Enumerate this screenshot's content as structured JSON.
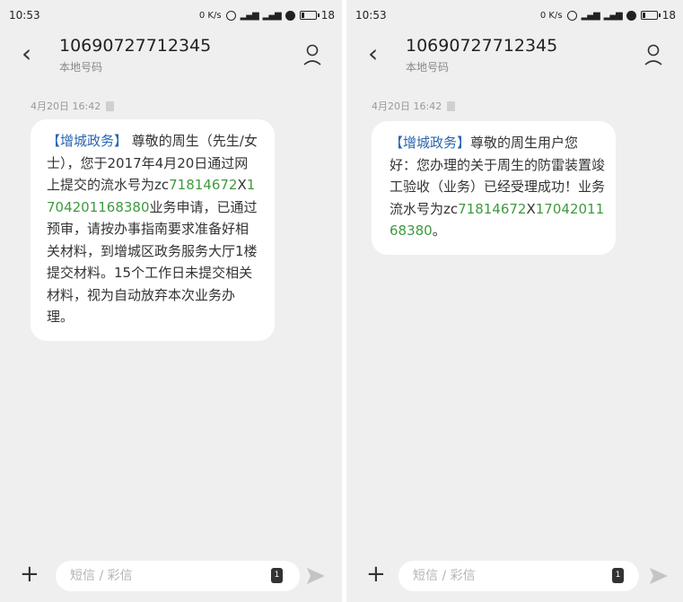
{
  "status": {
    "time": "10:53",
    "speed": "0 K/s",
    "network": "4G",
    "battery": "18"
  },
  "conversation": {
    "phone_number": "10690727712345",
    "number_type": "本地号码",
    "timestamp": "4月20日 16:42"
  },
  "messages": [
    {
      "brand": "【增城政务】",
      "text_before": " 尊敬的周生（先生/女士），您于2017年4月20日通过网上提交的流水号为zc",
      "num1": "71814672",
      "sep": "X",
      "num2": "1704201168380",
      "text_after": "业务申请，已通过预审，请按办事指南要求准备好相关材料，到增城区政务服务大厅1楼提交材料。15个工作日未提交相关材料，视为自动放弃本次业务办理。"
    },
    {
      "brand": "【增城政务】",
      "text_before": "尊敬的周生用户您好：您办理的关于周生的防雷装置竣工验收（业务）已经受理成功！业务流水号为zc",
      "num1": "71814672",
      "sep": "X",
      "num2": "1704201168380",
      "text_after": "。"
    }
  ],
  "input": {
    "placeholder": "短信 / 彩信",
    "sim_label": "1"
  },
  "icons": {
    "back": "chevron-left-icon",
    "contact": "person-icon",
    "attach": "plus-icon",
    "sim": "sim-card-icon",
    "send": "send-icon"
  }
}
